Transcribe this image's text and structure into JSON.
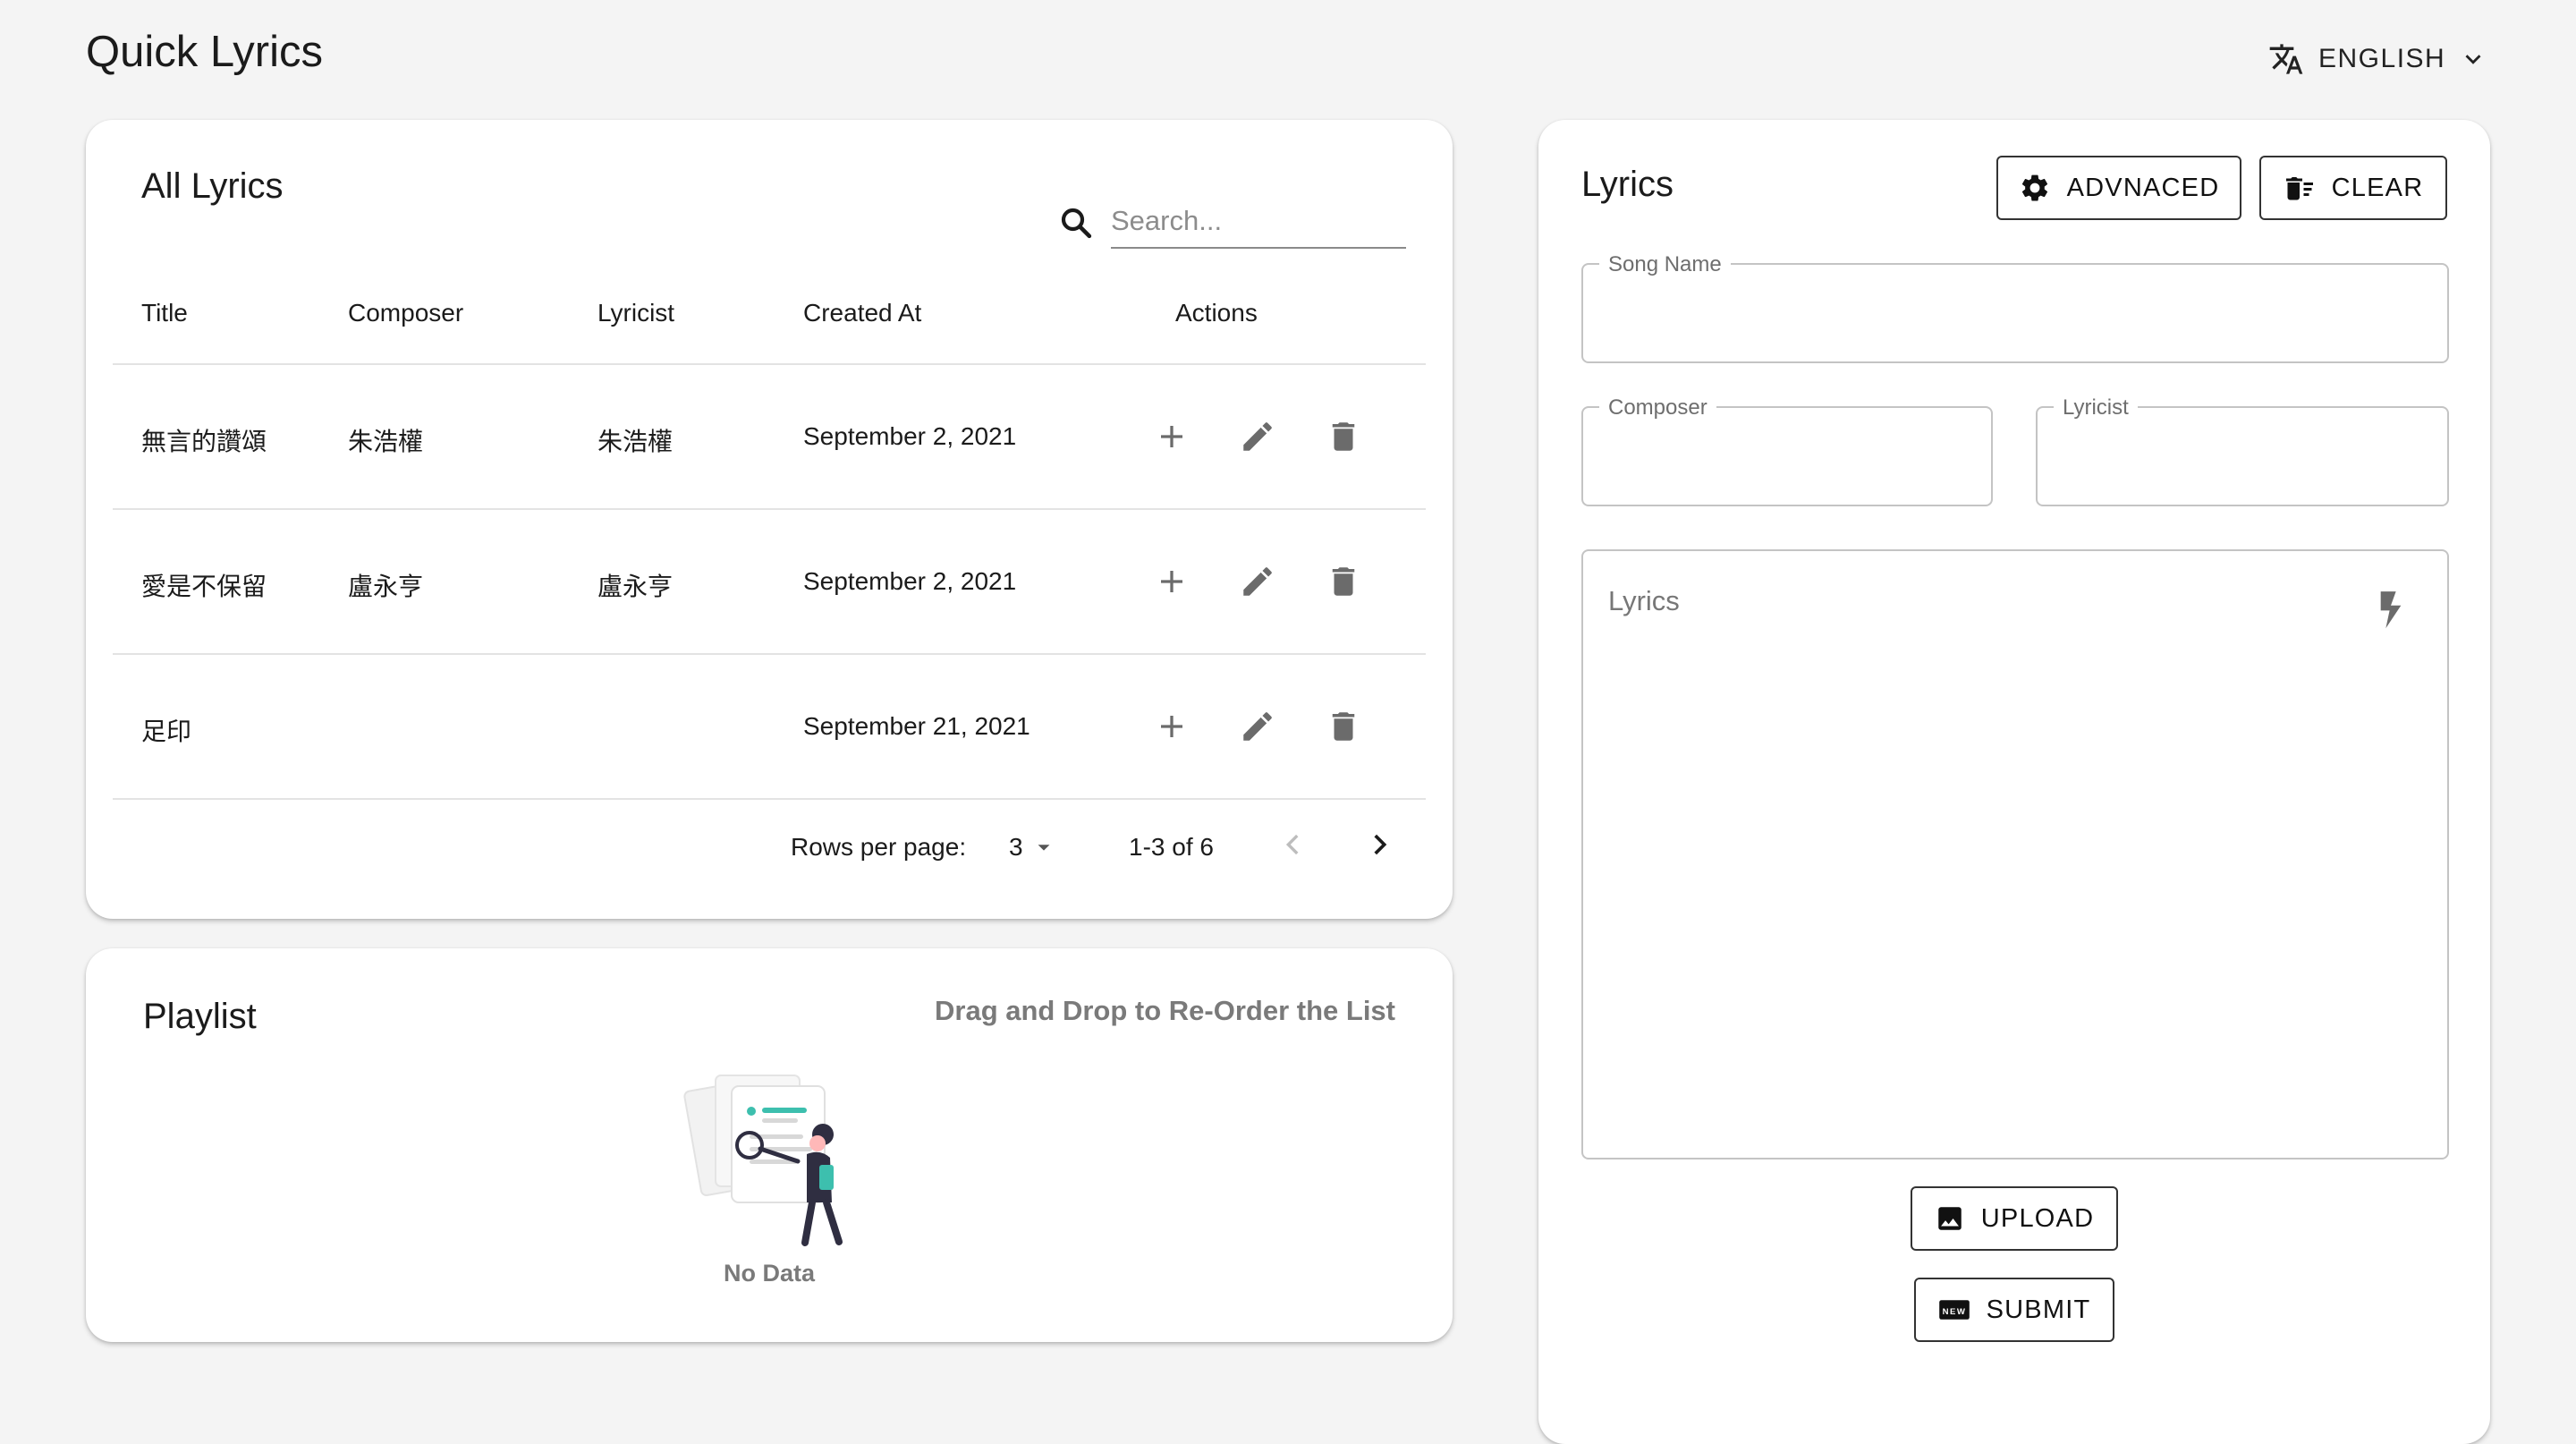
{
  "app": {
    "title": "Quick Lyrics"
  },
  "language": {
    "selected": "ENGLISH"
  },
  "lyrics_list": {
    "title": "All Lyrics",
    "search_placeholder": "Search...",
    "columns": [
      "Title",
      "Composer",
      "Lyricist",
      "Created At",
      "Actions"
    ],
    "rows": [
      {
        "title": "無言的讚頌",
        "composer": "朱浩權",
        "lyricist": "朱浩權",
        "created_at": "September 2, 2021"
      },
      {
        "title": "愛是不保留",
        "composer": "盧永亨",
        "lyricist": "盧永亨",
        "created_at": "September 2, 2021"
      },
      {
        "title": "足印",
        "composer": "",
        "lyricist": "",
        "created_at": "September 21, 2021"
      }
    ],
    "pagination": {
      "rows_per_page_label": "Rows per page:",
      "rows_per_page": "3",
      "range": "1-3 of 6"
    }
  },
  "playlist": {
    "title": "Playlist",
    "hint": "Drag and Drop to Re-Order the List",
    "empty_text": "No Data"
  },
  "editor": {
    "title": "Lyrics",
    "advanced_label": "ADVNACED",
    "clear_label": "CLEAR",
    "song_name_label": "Song Name",
    "composer_label": "Composer",
    "lyricist_label": "Lyricist",
    "lyrics_placeholder": "Lyrics",
    "upload_label": "UPLOAD",
    "submit_label": "SUBMIT"
  },
  "colors": {
    "background": "#f4f4f4",
    "card": "#ffffff",
    "icon": "#6b6b6b",
    "illustration_accent": "#3dbfae"
  }
}
